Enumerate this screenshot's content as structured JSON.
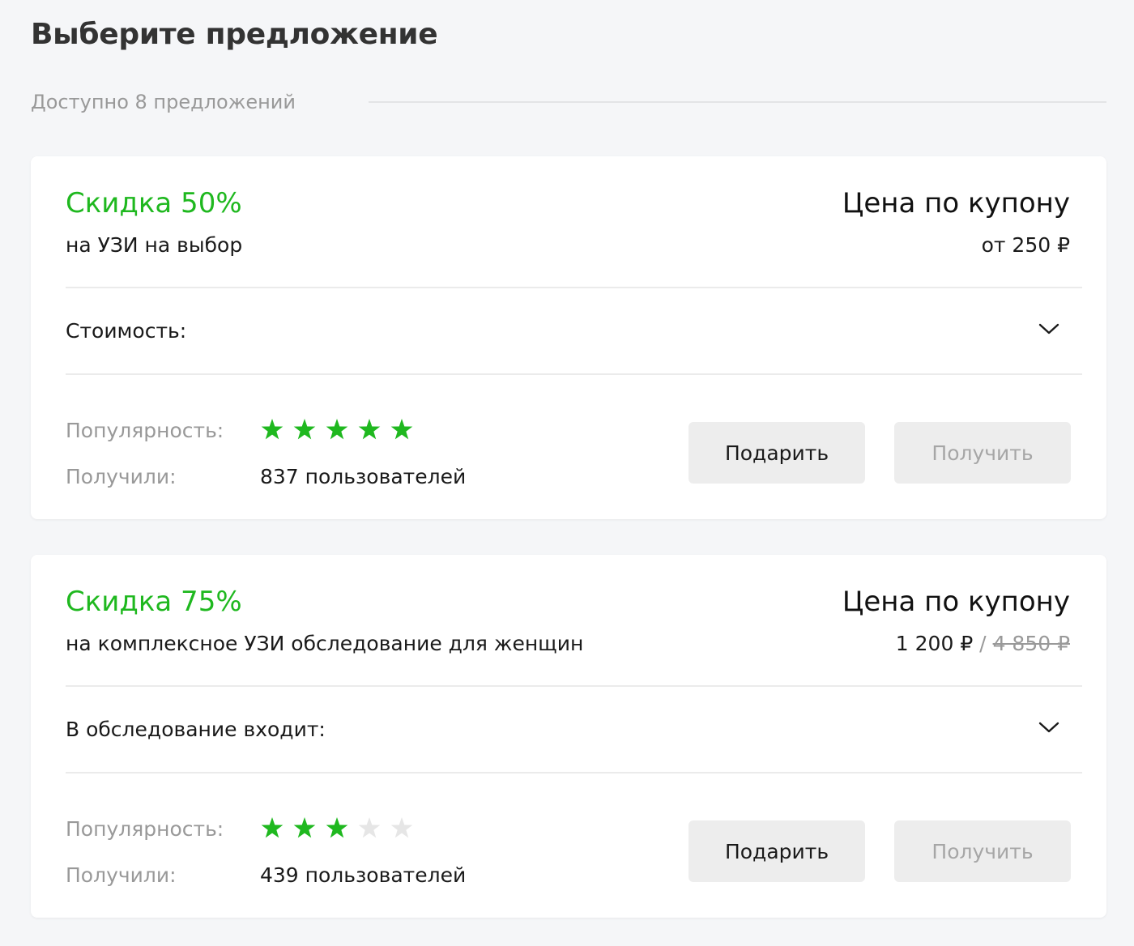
{
  "header": {
    "title": "Выберите предложение",
    "subtitle": "Доступно 8 предложений"
  },
  "colors": {
    "accent_green": "#1fb81f",
    "star_empty": "#e6e6e6",
    "muted_text": "#999999",
    "button_bg": "#ededed"
  },
  "offers": [
    {
      "discount": "Скидка 50%",
      "description": "на УЗИ на выбор",
      "coupon_title": "Цена по купону",
      "price": "от 250 ₽",
      "price_separator": "",
      "old_price": "",
      "expander_label": "Стоимость:",
      "expander_icon": "chevron-down-icon",
      "popularity_label": "Популярность:",
      "popularity_stars": 5,
      "popularity_max": 5,
      "received_label": "Получили:",
      "received_users": "837 пользователей",
      "gift_button": "Подарить",
      "get_button": "Получить"
    },
    {
      "discount": "Скидка 75%",
      "description": "на комплексное УЗИ обследование для женщин",
      "coupon_title": "Цена по купону",
      "price": "1 200 ₽",
      "price_separator": " / ",
      "old_price": "4 850 ₽",
      "expander_label": "В обследование входит:",
      "expander_icon": "chevron-down-icon",
      "popularity_label": "Популярность:",
      "popularity_stars": 3,
      "popularity_max": 5,
      "received_label": "Получили:",
      "received_users": "439 пользователей",
      "gift_button": "Подарить",
      "get_button": "Получить"
    }
  ]
}
